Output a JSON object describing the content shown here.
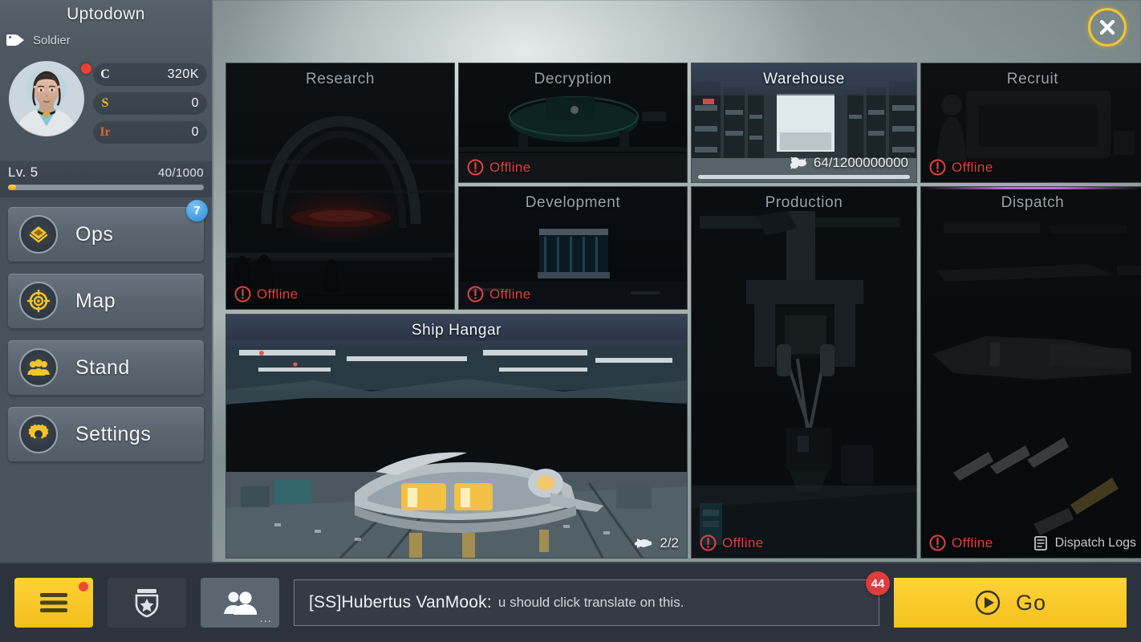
{
  "sidebar": {
    "username": "Uptodown",
    "rank_tag": {
      "label": "Soldier",
      "icon": "tag-icon"
    },
    "avatar": {
      "icon": "avatar",
      "notify_dot": true
    },
    "resources": [
      {
        "symbol": "C",
        "value": "320K",
        "color": "#f2f5f8"
      },
      {
        "symbol": "S",
        "value": "0",
        "color": "#e9b928"
      },
      {
        "symbol": "Ir",
        "value": "0",
        "color": "#e0623a"
      }
    ],
    "level": {
      "label": "Lv. 5",
      "xp": "40/1000",
      "progress_pct": 4
    },
    "menu": [
      {
        "label": "Ops",
        "icon": "diamond-icon",
        "badge": "7"
      },
      {
        "label": "Map",
        "icon": "target-icon",
        "badge": ""
      },
      {
        "label": "Stand",
        "icon": "people-icon",
        "badge": ""
      },
      {
        "label": "Settings",
        "icon": "gear-icon",
        "badge": ""
      }
    ]
  },
  "header": {
    "close_icon": "close-icon"
  },
  "facilities": [
    {
      "key": "research",
      "title": "Research",
      "state": "dim",
      "status": "Offline",
      "status_icon": "alert-icon"
    },
    {
      "key": "decryption",
      "title": "Decryption",
      "state": "dim",
      "status": "Offline",
      "status_icon": "alert-icon"
    },
    {
      "key": "development",
      "title": "Development",
      "state": "dim",
      "status": "Offline",
      "status_icon": "alert-icon"
    },
    {
      "key": "ship-hangar",
      "title": "Ship Hangar",
      "state": "lit",
      "status": "",
      "meta_icon": "ship-icon",
      "meta": "2/2"
    },
    {
      "key": "warehouse",
      "title": "Warehouse",
      "state": "lit",
      "status": "",
      "meta_icon": "cargo-icon",
      "meta": "64/1200000000",
      "capacity_pct": 100
    },
    {
      "key": "production",
      "title": "Production",
      "state": "dim",
      "status": "Offline",
      "status_icon": "alert-icon"
    },
    {
      "key": "recruit",
      "title": "Recruit",
      "state": "dim",
      "status": "Offline",
      "status_icon": "alert-icon"
    },
    {
      "key": "dispatch",
      "title": "Dispatch",
      "state": "dim",
      "status": "Offline",
      "status_icon": "alert-icon",
      "meta_icon": "logs-icon",
      "meta": "Dispatch Logs",
      "accent_color": "#b96cd8"
    }
  ],
  "bottombar": {
    "menu_button": {
      "icon": "hamburger-icon",
      "notify": true
    },
    "rank_button": {
      "icon": "shield-star-icon"
    },
    "social_button": {
      "icon": "people-icon",
      "more": "..."
    },
    "chat": {
      "author": "[SS]Hubertus VanMook:",
      "message": "u should click translate on this.",
      "unread": "44"
    },
    "go_button": {
      "label": "Go",
      "icon": "play-icon"
    }
  },
  "colors": {
    "accent_yellow": "#f5c52a",
    "offline_red": "#e0413f",
    "badge_blue": "#3d9ae0",
    "badge_red": "#e03c3c",
    "dispatch_purple": "#b96cd8"
  }
}
